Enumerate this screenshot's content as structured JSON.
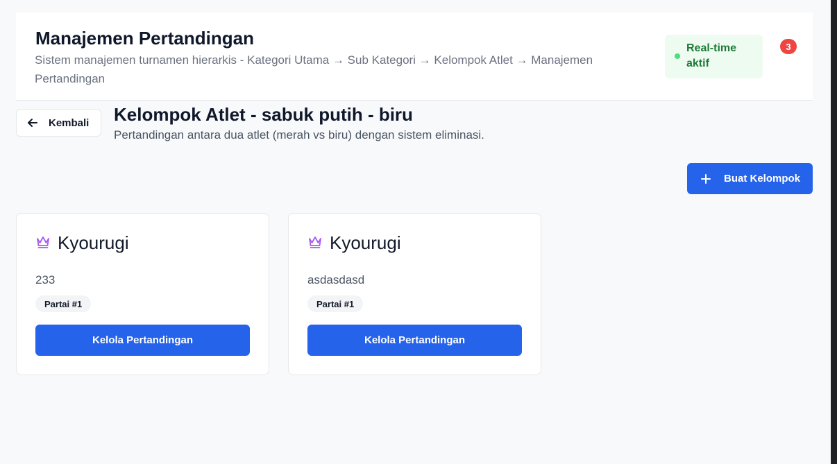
{
  "header": {
    "title": "Manajemen Pertandingan",
    "subtitle": "Sistem manajemen turnamen hierarkis - Kategori Utama → Sub Kategori → Kelompok Atlet → Manajemen Pertandingan",
    "status_label": "Real-time aktif",
    "status_color": "#4ade80",
    "notification_count": "3",
    "notification_color": "#ef4444"
  },
  "page": {
    "back_label": "Kembali",
    "back_icon": "arrow-left-icon",
    "title": "Kelompok Atlet - sabuk putih - biru",
    "description": "Pertandingan antara dua atlet (merah vs biru) dengan sistem eliminasi.",
    "create_label": "Buat Kelompok",
    "create_icon": "plus-icon",
    "accent_color": "#2563eb"
  },
  "cards": [
    {
      "icon": "crown-icon",
      "title": "Kyourugi",
      "description": "233",
      "badge": "Partai #1",
      "action_label": "Kelola Pertandingan"
    },
    {
      "icon": "crown-icon",
      "title": "Kyourugi",
      "description": "asdasdasd",
      "badge": "Partai #1",
      "action_label": "Kelola Pertandingan"
    }
  ]
}
